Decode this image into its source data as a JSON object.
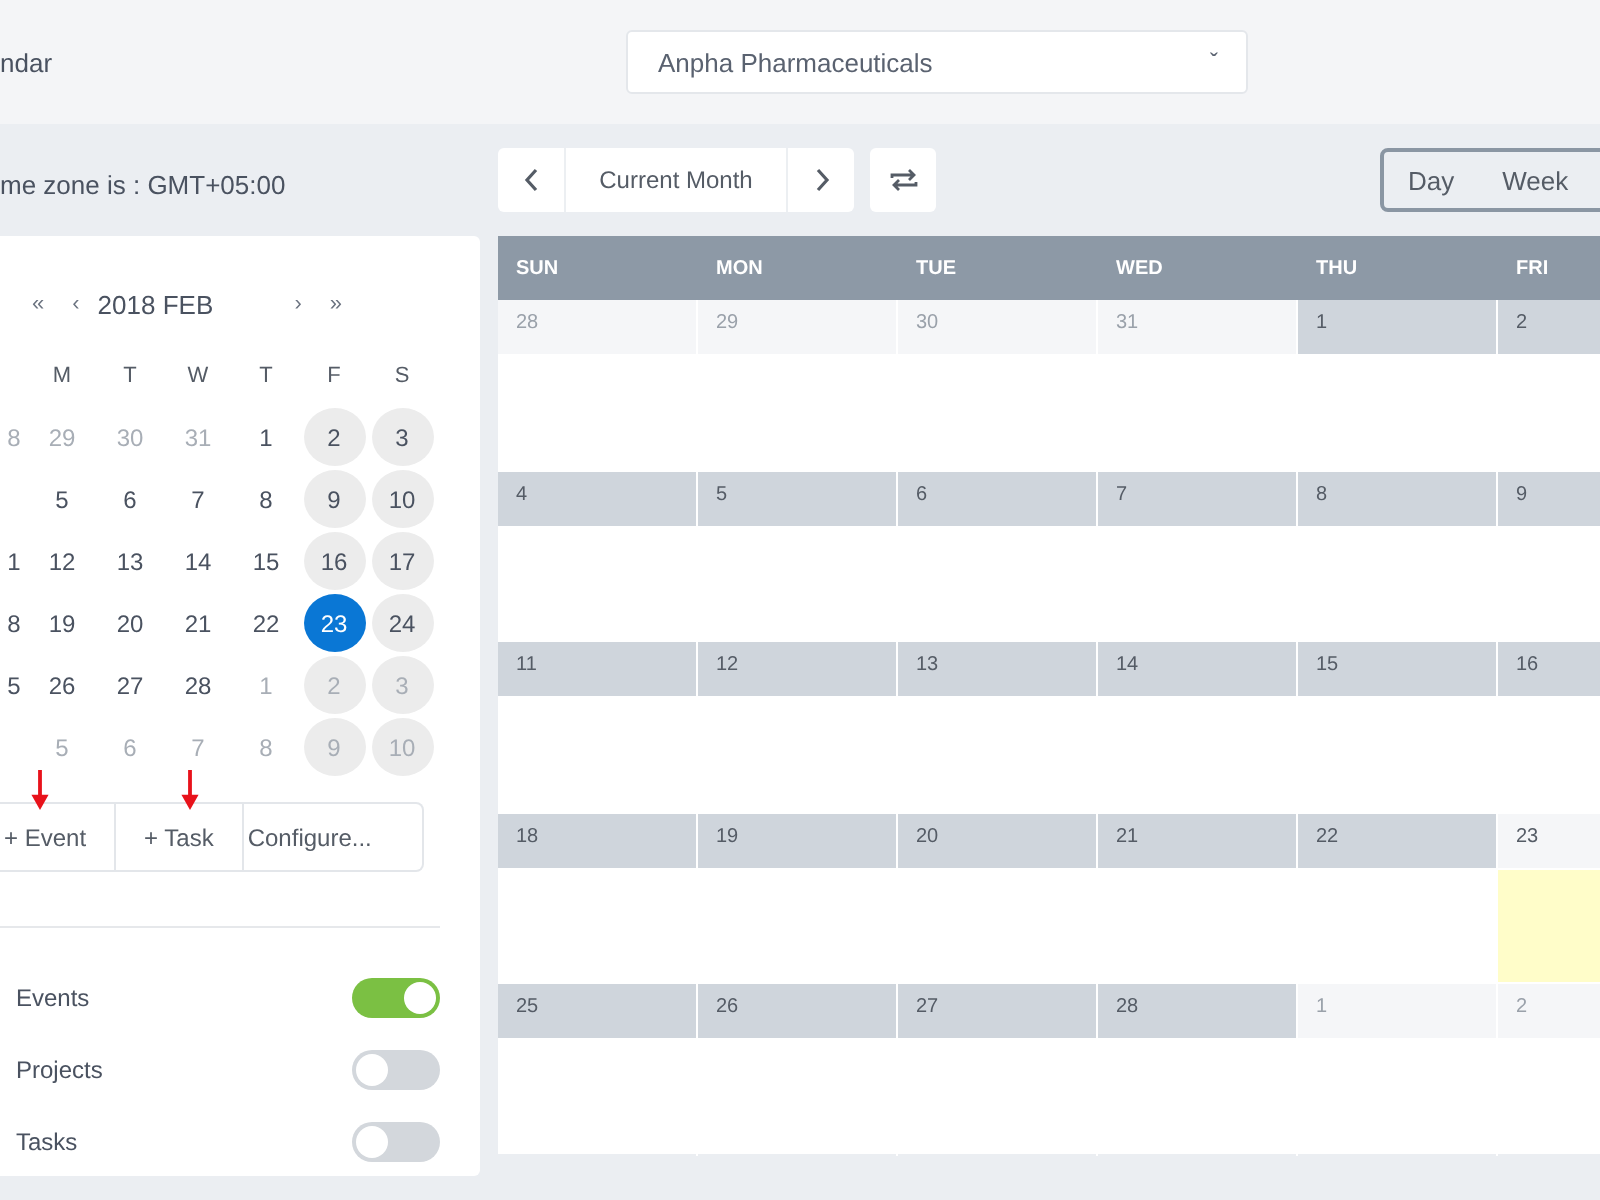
{
  "header": {
    "title": "ndar",
    "company_select": {
      "value": "Anpha Pharmaceuticals",
      "caret": "ˇ"
    }
  },
  "timezone": "me zone is : GMT+05:00",
  "mini_calendar": {
    "prev": [
      "«",
      "‹"
    ],
    "title": "2018 FEB",
    "next": [
      "›",
      "»"
    ],
    "weekdays": [
      "M",
      "T",
      "W",
      "T",
      "F",
      "S"
    ],
    "weeks": [
      [
        {
          "day": "8",
          "other_month": true,
          "weekend": false,
          "selected": false
        },
        {
          "day": "29",
          "other_month": true,
          "weekend": false,
          "selected": false
        },
        {
          "day": "30",
          "other_month": true,
          "weekend": false,
          "selected": false
        },
        {
          "day": "31",
          "other_month": true,
          "weekend": false,
          "selected": false
        },
        {
          "day": "1",
          "other_month": false,
          "weekend": false,
          "selected": false
        },
        {
          "day": "2",
          "other_month": false,
          "weekend": true,
          "selected": false
        },
        {
          "day": "3",
          "other_month": false,
          "weekend": true,
          "selected": false
        }
      ],
      [
        {
          "day": "5",
          "other_month": false,
          "weekend": false,
          "selected": false
        },
        {
          "day": "6",
          "other_month": false,
          "weekend": false,
          "selected": false
        },
        {
          "day": "7",
          "other_month": false,
          "weekend": false,
          "selected": false
        },
        {
          "day": "8",
          "other_month": false,
          "weekend": false,
          "selected": false
        },
        {
          "day": "9",
          "other_month": false,
          "weekend": true,
          "selected": false
        },
        {
          "day": "10",
          "other_month": false,
          "weekend": true,
          "selected": false
        }
      ],
      [
        {
          "day": "1",
          "other_month": false,
          "weekend": false,
          "selected": false
        },
        {
          "day": "12",
          "other_month": false,
          "weekend": false,
          "selected": false
        },
        {
          "day": "13",
          "other_month": false,
          "weekend": false,
          "selected": false
        },
        {
          "day": "14",
          "other_month": false,
          "weekend": false,
          "selected": false
        },
        {
          "day": "15",
          "other_month": false,
          "weekend": false,
          "selected": false
        },
        {
          "day": "16",
          "other_month": false,
          "weekend": true,
          "selected": false
        },
        {
          "day": "17",
          "other_month": false,
          "weekend": true,
          "selected": false
        }
      ],
      [
        {
          "day": "8",
          "other_month": false,
          "weekend": false,
          "selected": false
        },
        {
          "day": "19",
          "other_month": false,
          "weekend": false,
          "selected": false
        },
        {
          "day": "20",
          "other_month": false,
          "weekend": false,
          "selected": false
        },
        {
          "day": "21",
          "other_month": false,
          "weekend": false,
          "selected": false
        },
        {
          "day": "22",
          "other_month": false,
          "weekend": false,
          "selected": false
        },
        {
          "day": "23",
          "other_month": false,
          "weekend": true,
          "selected": true
        },
        {
          "day": "24",
          "other_month": false,
          "weekend": true,
          "selected": false
        }
      ],
      [
        {
          "day": "5",
          "other_month": false,
          "weekend": false,
          "selected": false
        },
        {
          "day": "26",
          "other_month": false,
          "weekend": false,
          "selected": false
        },
        {
          "day": "27",
          "other_month": false,
          "weekend": false,
          "selected": false
        },
        {
          "day": "28",
          "other_month": false,
          "weekend": false,
          "selected": false
        },
        {
          "day": "1",
          "other_month": true,
          "weekend": false,
          "selected": false
        },
        {
          "day": "2",
          "other_month": true,
          "weekend": true,
          "selected": false
        },
        {
          "day": "3",
          "other_month": true,
          "weekend": true,
          "selected": false
        }
      ],
      [
        {
          "day": "5",
          "other_month": true,
          "weekend": false,
          "selected": false
        },
        {
          "day": "6",
          "other_month": true,
          "weekend": false,
          "selected": false
        },
        {
          "day": "7",
          "other_month": true,
          "weekend": false,
          "selected": false
        },
        {
          "day": "8",
          "other_month": true,
          "weekend": false,
          "selected": false
        },
        {
          "day": "9",
          "other_month": true,
          "weekend": true,
          "selected": false
        },
        {
          "day": "10",
          "other_month": true,
          "weekend": true,
          "selected": false
        }
      ]
    ]
  },
  "actions": [
    {
      "label": "+ Event",
      "marked": true
    },
    {
      "label": "+ Task",
      "marked": true
    },
    {
      "label": "Configure...",
      "marked": false
    }
  ],
  "toggles": [
    {
      "label": "Events",
      "on": true
    },
    {
      "label": "Projects",
      "on": false
    },
    {
      "label": "Tasks",
      "on": false
    }
  ],
  "toolbar": {
    "period": "Current Month",
    "views": [
      "Day",
      "Week"
    ]
  },
  "grid": {
    "columns": [
      "SUN",
      "MON",
      "TUE",
      "WED",
      "THU",
      "FRI"
    ],
    "weeks": [
      [
        {
          "day": "28",
          "kind": "other"
        },
        {
          "day": "29",
          "kind": "other"
        },
        {
          "day": "30",
          "kind": "other"
        },
        {
          "day": "31",
          "kind": "other"
        },
        {
          "day": "1",
          "kind": "current"
        },
        {
          "day": "2",
          "kind": "current"
        }
      ],
      [
        {
          "day": "4",
          "kind": "current"
        },
        {
          "day": "5",
          "kind": "current"
        },
        {
          "day": "6",
          "kind": "current"
        },
        {
          "day": "7",
          "kind": "current"
        },
        {
          "day": "8",
          "kind": "current"
        },
        {
          "day": "9",
          "kind": "current"
        }
      ],
      [
        {
          "day": "11",
          "kind": "current"
        },
        {
          "day": "12",
          "kind": "current"
        },
        {
          "day": "13",
          "kind": "current"
        },
        {
          "day": "14",
          "kind": "current"
        },
        {
          "day": "15",
          "kind": "current"
        },
        {
          "day": "16",
          "kind": "current"
        }
      ],
      [
        {
          "day": "18",
          "kind": "current"
        },
        {
          "day": "19",
          "kind": "current"
        },
        {
          "day": "20",
          "kind": "current"
        },
        {
          "day": "21",
          "kind": "current"
        },
        {
          "day": "22",
          "kind": "current"
        },
        {
          "day": "23",
          "kind": "today"
        }
      ],
      [
        {
          "day": "25",
          "kind": "current"
        },
        {
          "day": "26",
          "kind": "current"
        },
        {
          "day": "27",
          "kind": "current"
        },
        {
          "day": "28",
          "kind": "current"
        },
        {
          "day": "1",
          "kind": "other"
        },
        {
          "day": "2",
          "kind": "other"
        }
      ]
    ]
  }
}
